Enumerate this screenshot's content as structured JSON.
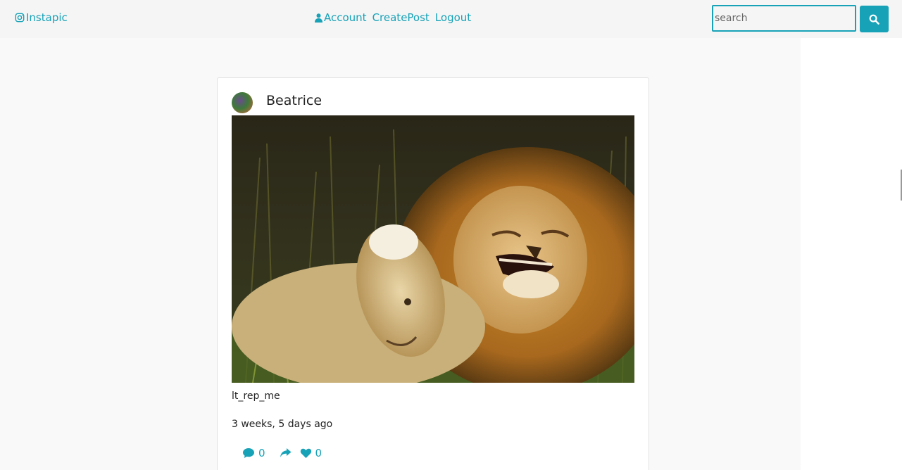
{
  "navbar": {
    "brand": "Instapic",
    "links": [
      {
        "label": "Account"
      },
      {
        "label": "CreatePost"
      },
      {
        "label": "Logout"
      }
    ],
    "search": {
      "placeholder": "search",
      "value": ""
    }
  },
  "post": {
    "author": "Beatrice",
    "caption": "lt_rep_me",
    "timestamp": "3 weeks, 5 days ago",
    "comments_count": "0",
    "likes_count": "0"
  },
  "icons": {
    "brand": "instagram-icon",
    "account": "user-icon",
    "search": "search-icon",
    "comment": "comment-icon",
    "share": "share-icon",
    "like": "heart-icon"
  },
  "colors": {
    "accent": "#17a2b8",
    "navbar_bg": "#f5f5f5",
    "content_bg": "#f9f9f9"
  }
}
